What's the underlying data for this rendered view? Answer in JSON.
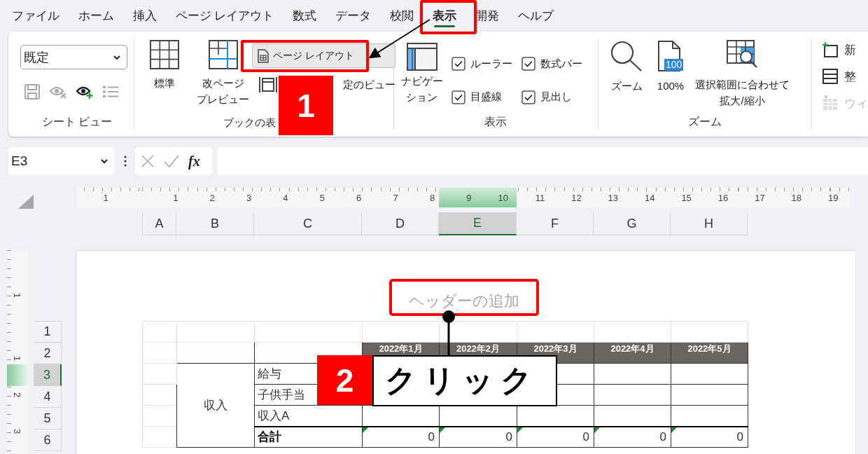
{
  "tabs": [
    {
      "label": "ファイル",
      "selected": false
    },
    {
      "label": "ホーム",
      "selected": false
    },
    {
      "label": "挿入",
      "selected": false
    },
    {
      "label": "ページ レイアウト",
      "selected": false
    },
    {
      "label": "数式",
      "selected": false
    },
    {
      "label": "データ",
      "selected": false
    },
    {
      "label": "校閲",
      "selected": false
    },
    {
      "label": "表示",
      "selected": true
    },
    {
      "label": "開発",
      "selected": false
    },
    {
      "label": "ヘルプ",
      "selected": false
    }
  ],
  "sheet_view": {
    "label": "シート ビュー",
    "dropdown": "既定",
    "tools": [
      {
        "kind": "save",
        "disabled": true
      },
      {
        "kind": "exit",
        "disabled": true
      },
      {
        "kind": "new",
        "disabled": false
      },
      {
        "kind": "options",
        "disabled": true
      }
    ]
  },
  "workbook_views": {
    "label": "ブックの表",
    "buttons": [
      {
        "kind": "normal",
        "lines": [
          "標準"
        ],
        "selected": false
      },
      {
        "kind": "break",
        "lines": [
          "改ページ",
          "プレビュー"
        ],
        "selected": false
      },
      {
        "kind": "layout",
        "lines": [
          "ページ レイアウト"
        ],
        "selected": true
      }
    ],
    "custom_view": "定のビュー"
  },
  "show": {
    "label": "表示",
    "navigation": [
      "ナビゲー",
      "ション"
    ],
    "checkboxes": [
      {
        "label": "ルーラー",
        "checked": true
      },
      {
        "label": "数式バー",
        "checked": true
      },
      {
        "label": "目盛線",
        "checked": true
      },
      {
        "label": "見出し",
        "checked": true
      }
    ]
  },
  "zoom": {
    "label": "ズーム",
    "buttons": [
      {
        "kind": "zoom",
        "lines": [
          "ズーム"
        ]
      },
      {
        "kind": "hundred",
        "badge": "100",
        "lines": [
          "100%"
        ]
      },
      {
        "kind": "selection",
        "lines": [
          "選択範囲に合わせて",
          "拡大/縮小"
        ]
      }
    ]
  },
  "window_group": {
    "items": [
      {
        "kind": "new",
        "label": "新",
        "disabled": false
      },
      {
        "kind": "arrange",
        "label": "整",
        "disabled": false
      },
      {
        "kind": "freeze",
        "label": "ウィ",
        "disabled": true
      }
    ]
  },
  "formula_bar": {
    "name_box": "E3",
    "fx": "fx"
  },
  "ruler": {
    "labels": [
      "1",
      "1",
      "2",
      "3",
      "4",
      "5",
      "6",
      "7",
      "8",
      "9",
      "10",
      "11",
      "12",
      "13",
      "14",
      "15",
      "16",
      "17",
      "18",
      "19"
    ]
  },
  "columns": [
    {
      "label": "A",
      "selected": false
    },
    {
      "label": "B",
      "selected": false
    },
    {
      "label": "C",
      "selected": false
    },
    {
      "label": "D",
      "selected": false
    },
    {
      "label": "E",
      "selected": true
    },
    {
      "label": "F",
      "selected": false
    },
    {
      "label": "G",
      "selected": false
    },
    {
      "label": "H",
      "selected": false
    }
  ],
  "vruler": {
    "labels": [
      "1",
      "1",
      "2",
      "3"
    ]
  },
  "rows": [
    {
      "label": "1",
      "selected": false
    },
    {
      "label": "2",
      "selected": false
    },
    {
      "label": "3",
      "selected": true
    },
    {
      "label": "4",
      "selected": false
    },
    {
      "label": "5",
      "selected": false
    },
    {
      "label": "6",
      "selected": false
    }
  ],
  "page": {
    "header_placeholder": "ヘッダーの追加"
  },
  "table": {
    "headers": [
      "2022年1月",
      "2022年2月",
      "2022年3月",
      "2022年4月",
      "2022年5月"
    ],
    "group": "収入",
    "items": [
      {
        "label": "給与",
        "bold": false,
        "flagged": false
      },
      {
        "label": "子供手当",
        "bold": false,
        "flagged": false
      },
      {
        "label": "収入A",
        "bold": false,
        "flagged": false
      },
      {
        "label": "合計",
        "bold": true,
        "flagged": true,
        "values": [
          "0",
          "0",
          "0",
          "0",
          "0"
        ]
      }
    ]
  },
  "callouts": [
    {
      "number": "1"
    },
    {
      "number": "2",
      "text": "クリック"
    }
  ]
}
